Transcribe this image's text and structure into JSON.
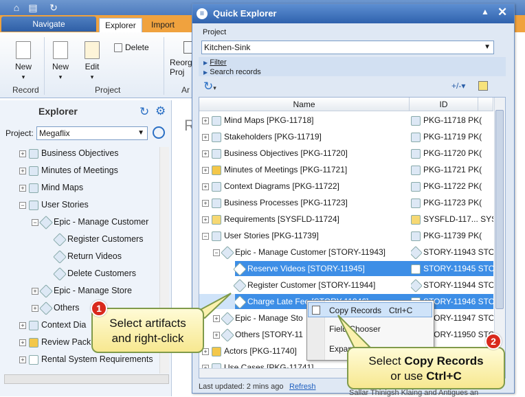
{
  "app": {
    "nav_tab": "Navigate",
    "ribbon_tabs": [
      "Explorer",
      "Import"
    ],
    "ribbon_buttons": {
      "new1": "New",
      "new2": "New",
      "edit": "Edit",
      "delete": "Delete",
      "reorg": "Reorg",
      "proj": "Proj",
      "ar": "Ar"
    },
    "groups": {
      "record": "Record",
      "project": "Project"
    }
  },
  "explorer": {
    "title": "Explorer",
    "project_label": "Project:",
    "project_value": "Megaflix",
    "tree": [
      {
        "label": "Business Objectives"
      },
      {
        "label": "Minutes of Meetings"
      },
      {
        "label": "Mind Maps"
      },
      {
        "label": "User Stories"
      },
      {
        "label": "Epic - Manage Customer"
      },
      {
        "label": "Register Customers"
      },
      {
        "label": "Return Videos"
      },
      {
        "label": "Delete Customers"
      },
      {
        "label": "Epic - Manage Store"
      },
      {
        "label": "Others"
      },
      {
        "label": "Context Dia"
      },
      {
        "label": "Review Pack"
      },
      {
        "label": "Rental System Requirements"
      }
    ]
  },
  "quick_explorer": {
    "title": "Quick Explorer",
    "project_label": "Project",
    "project_value": "Kitchen-Sink",
    "filter_label": "Filter",
    "search_label": "Search records",
    "col_name": "Name",
    "col_id": "ID",
    "rows": [
      {
        "name": "Mind Maps [PKG-11718]",
        "id": "PKG-11718",
        "extra": "PK("
      },
      {
        "name": "Stakeholders [PKG-11719]",
        "id": "PKG-11719",
        "extra": "PK("
      },
      {
        "name": "Business Objectives [PKG-11720]",
        "id": "PKG-11720",
        "extra": "PK("
      },
      {
        "name": "Minutes of Meetings [PKG-11721]",
        "id": "PKG-11721",
        "extra": "PK("
      },
      {
        "name": "Context Diagrams [PKG-11722]",
        "id": "PKG-11722",
        "extra": "PK("
      },
      {
        "name": "Business Processes [PKG-11723]",
        "id": "PKG-11723",
        "extra": "PK("
      },
      {
        "name": "Requirements [SYSFLD-11724]",
        "id": "SYSFLD-117...",
        "extra": "SYS"
      },
      {
        "name": "User Stories [PKG-11739]",
        "id": "PKG-11739",
        "extra": "PK("
      },
      {
        "name": "Epic - Manage Customer [STORY-11943]",
        "id": "STORY-11943",
        "extra": "STO"
      },
      {
        "name": "Reserve Videos [STORY-11945]",
        "id": "STORY-11945",
        "extra": "STO"
      },
      {
        "name": "Register Customer [STORY-11944]",
        "id": "STORY-11944",
        "extra": "STO"
      },
      {
        "name": "Charge Late Fee [STORY-11946]",
        "id": "STORY-11946",
        "extra": "STO"
      },
      {
        "name": "Epic - Manage Sto",
        "id": "STORY-11947",
        "extra": "STO"
      },
      {
        "name": "Others [STORY-11",
        "id": "STORY-11950",
        "extra": "STO"
      },
      {
        "name": "Actors [PKG-11740]",
        "id": "",
        "extra": ""
      },
      {
        "name": "Use Cases [PKG-11741]",
        "id": "",
        "extra": ""
      }
    ],
    "footer_text": "Last updated: 2 mins ago",
    "refresh_link": "Refresh"
  },
  "context_menu": {
    "copy": "Copy Records",
    "copy_shortcut": "Ctrl+C",
    "field_chooser": "Field Chooser",
    "expand": "Expan"
  },
  "callouts": {
    "c1_badge": "1",
    "c1_line1": "Select artifacts",
    "c1_line2": "and right-click",
    "c2_badge": "2",
    "c2_pre": "Select ",
    "c2_bold": "Copy Records",
    "c2_mid": "or use ",
    "c2_bold2": "Ctrl+C"
  },
  "main_peek": "R",
  "bottom_peek": "Sallar Thinigsh Klaing and Antigues an"
}
